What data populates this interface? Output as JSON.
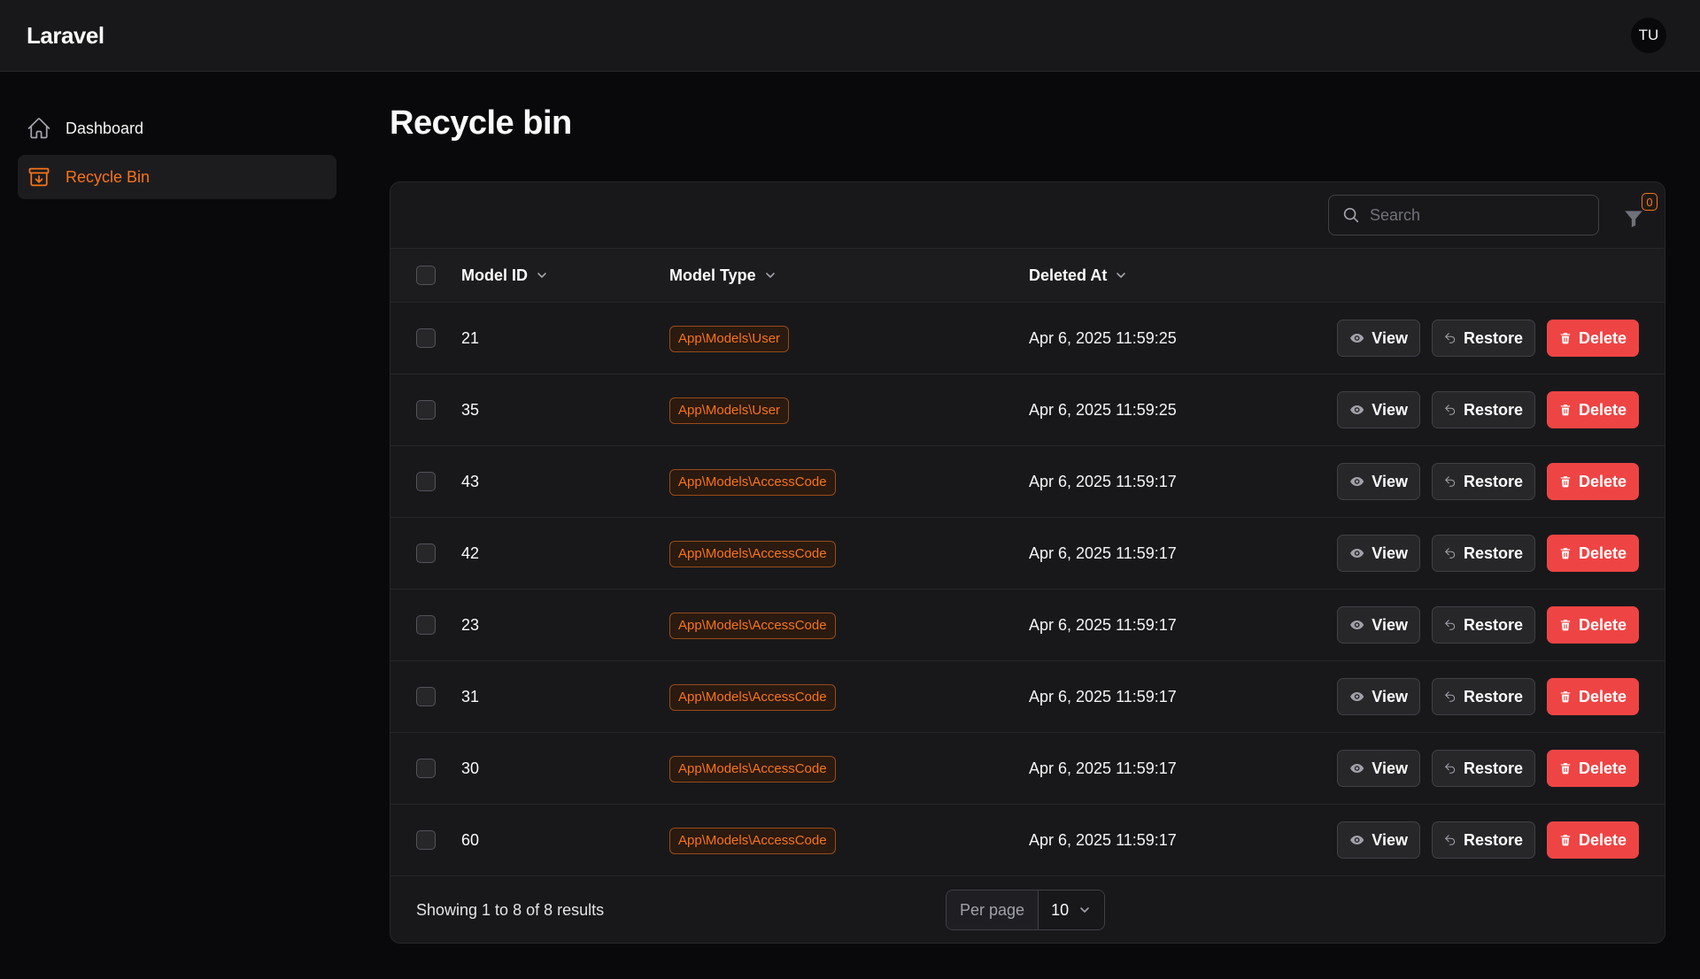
{
  "app": {
    "brand": "Laravel",
    "user_initials": "TU"
  },
  "sidebar": {
    "items": [
      {
        "label": "Dashboard",
        "icon": "home-icon",
        "active": false
      },
      {
        "label": "Recycle Bin",
        "icon": "archive-box-icon",
        "active": true
      }
    ]
  },
  "page": {
    "title": "Recycle bin"
  },
  "toolbar": {
    "search_placeholder": "Search",
    "filter_count": "0"
  },
  "table": {
    "columns": {
      "id": "Model ID",
      "type": "Model Type",
      "date": "Deleted At"
    },
    "rows": [
      {
        "id": "21",
        "type": "App\\Models\\User",
        "deleted_at": "Apr 6, 2025 11:59:25"
      },
      {
        "id": "35",
        "type": "App\\Models\\User",
        "deleted_at": "Apr 6, 2025 11:59:25"
      },
      {
        "id": "43",
        "type": "App\\Models\\AccessCode",
        "deleted_at": "Apr 6, 2025 11:59:17"
      },
      {
        "id": "42",
        "type": "App\\Models\\AccessCode",
        "deleted_at": "Apr 6, 2025 11:59:17"
      },
      {
        "id": "23",
        "type": "App\\Models\\AccessCode",
        "deleted_at": "Apr 6, 2025 11:59:17"
      },
      {
        "id": "31",
        "type": "App\\Models\\AccessCode",
        "deleted_at": "Apr 6, 2025 11:59:17"
      },
      {
        "id": "30",
        "type": "App\\Models\\AccessCode",
        "deleted_at": "Apr 6, 2025 11:59:17"
      },
      {
        "id": "60",
        "type": "App\\Models\\AccessCode",
        "deleted_at": "Apr 6, 2025 11:59:17"
      }
    ],
    "actions": {
      "view": "View",
      "restore": "Restore",
      "delete": "Delete"
    }
  },
  "footer": {
    "showing": "Showing 1 to 8 of 8 results",
    "per_page_label": "Per page",
    "per_page_value": "10"
  },
  "colors": {
    "accent": "#f97316",
    "danger": "#ef4444",
    "background": "#09090b",
    "surface": "#18181b"
  }
}
